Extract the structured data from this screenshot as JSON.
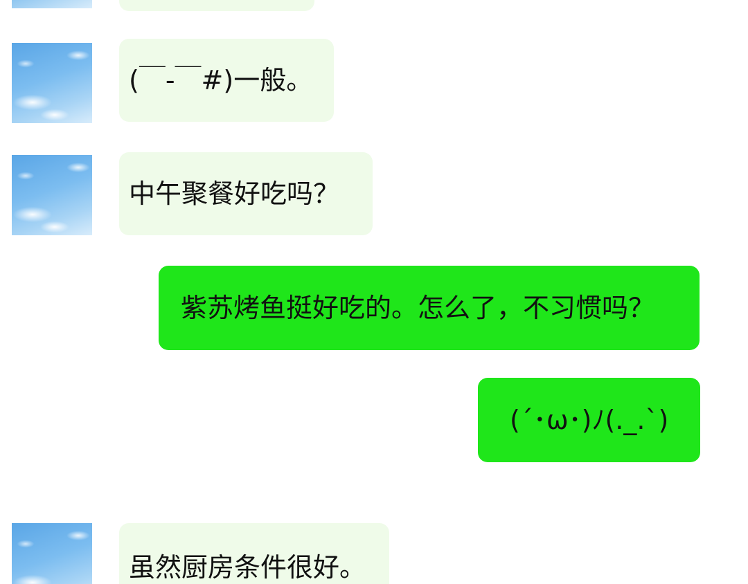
{
  "messages": [
    {
      "side": "incoming",
      "text": "(￣-￣#)一般。"
    },
    {
      "side": "incoming",
      "text": "中午聚餐好吃吗？"
    },
    {
      "side": "outgoing",
      "text": "紫苏烤鱼挺好吃的。怎么了，不习惯吗？"
    },
    {
      "side": "outgoing",
      "text": "(´･ω･)ﾉ(._.`)"
    },
    {
      "side": "incoming",
      "text": "虽然厨房条件很好。"
    }
  ],
  "colors": {
    "incoming_bubble": "#effbe9",
    "outgoing_bubble": "#1fe61a",
    "background": "#ffffff",
    "text": "#111111"
  },
  "avatar": {
    "icon": "sky-clouds-avatar"
  }
}
